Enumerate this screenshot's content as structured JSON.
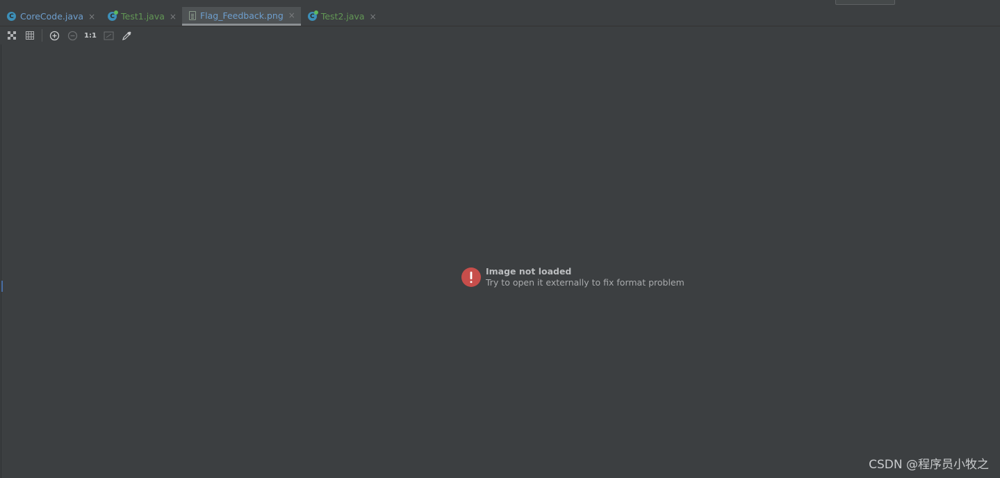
{
  "tabs": [
    {
      "label": "CoreCode.java",
      "icon": "class-icon",
      "color": "blue",
      "active": false
    },
    {
      "label": "Test1.java",
      "icon": "run-icon",
      "color": "green",
      "active": false
    },
    {
      "label": "Flag_Feedback.png",
      "icon": "image-icon",
      "color": "blue",
      "active": true
    },
    {
      "label": "Test2.java",
      "icon": "run-icon",
      "color": "green",
      "active": false
    }
  ],
  "tab_close_glyph": "×",
  "toolbar": {
    "actual_size_label": "1:1"
  },
  "message": {
    "title": "Image not loaded",
    "subtitle": "Try to open it externally to fix format problem"
  },
  "watermark": "CSDN @程序员小牧之",
  "colors": {
    "background": "#3c3f41",
    "error": "#c74e4b",
    "tab_blue": "#6e9fce",
    "tab_green": "#629755"
  }
}
